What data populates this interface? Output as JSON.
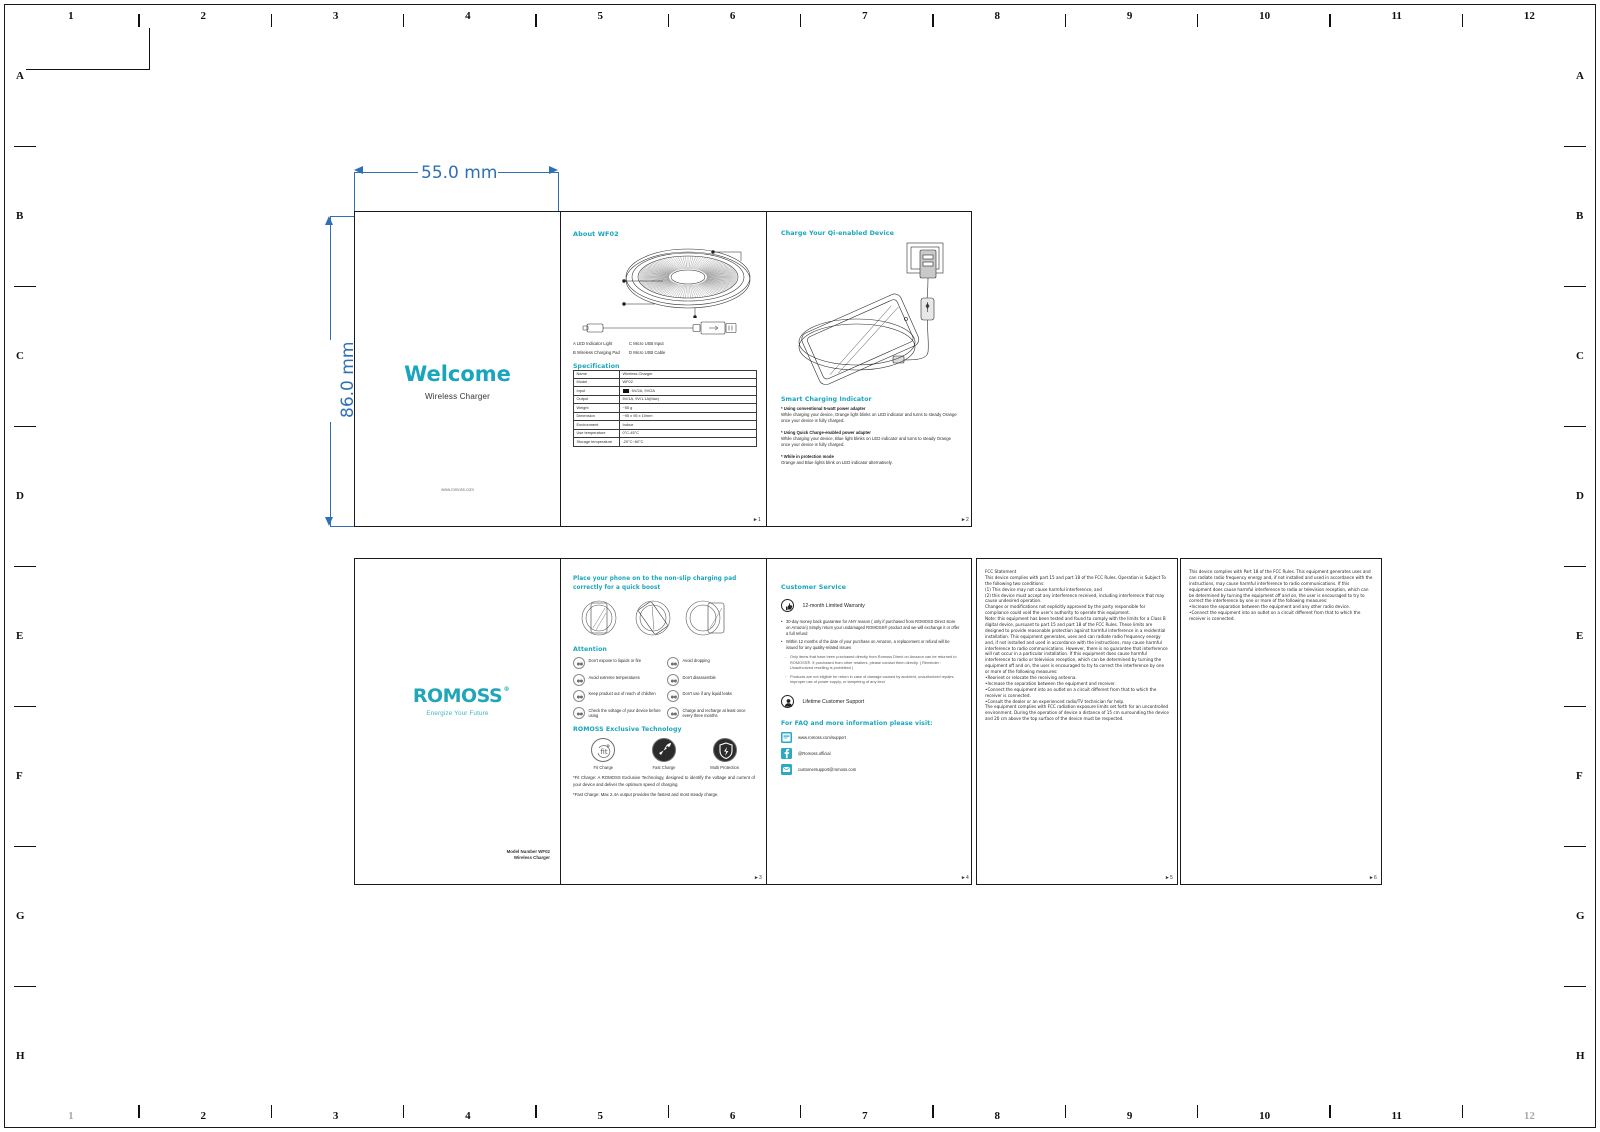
{
  "drawing": {
    "ruler_numbers_top": [
      "1",
      "2",
      "3",
      "4",
      "5",
      "6",
      "7",
      "8",
      "9",
      "10",
      "11",
      "12"
    ],
    "ruler_numbers_bottom": [
      "1",
      "2",
      "3",
      "4",
      "5",
      "6",
      "7",
      "8",
      "9",
      "10",
      "11",
      "12"
    ],
    "ruler_letters": [
      "A",
      "B",
      "C",
      "D",
      "E",
      "F",
      "G",
      "H"
    ],
    "dim_width": "55.0 mm",
    "dim_height": "86.0 mm"
  },
  "page1": {
    "title": "Welcome",
    "subtitle": "Wireless Charger",
    "url": "www.romoss.com",
    "page_mark": "►1"
  },
  "page2": {
    "about_heading": "About WF02",
    "legend": [
      "A  LED Indicator Light",
      "C  Micro USB Input",
      "B  Wireless Charging Pad",
      "D  Micro USB Cable"
    ],
    "spec_heading": "Specification",
    "spec_rows": [
      {
        "key": "Name",
        "value": "Wireless Charger"
      },
      {
        "key": "Model",
        "value": "WF02"
      },
      {
        "key": "Input",
        "value": ": 5V/2A, 9V/2A"
      },
      {
        "key": "Output",
        "value": "5V/1A, 9V/1.1A(Max)"
      },
      {
        "key": "Weight",
        "value": "~55 g"
      },
      {
        "key": "Dimension",
        "value": "~95 x 95 x 10mm"
      },
      {
        "key": "Environment",
        "value": "Indoor"
      },
      {
        "key": "Use temperature",
        "value": "0°C-45°C"
      },
      {
        "key": "Storage temperature",
        "value": "-20°C~60°C"
      }
    ]
  },
  "page3": {
    "heading": "Charge Your Qi-enabled Device",
    "indicator_heading": "Smart Charging Indicator",
    "blocks": [
      {
        "title": "* Using conventional 5-watt power adapter",
        "body": "While charging your device, Orange light blinks on LED indicator and turns to steady Orange once your device is fully charged."
      },
      {
        "title": "* Using Quick Charge-enabled power adapter",
        "body": "While charging your device, Blue light blinks on LED indicator and turns to steady Orange once your device is fully charged."
      },
      {
        "title": "* While in protection mode",
        "body": "Orange and Blue lights blink on LED indicator alternatively."
      }
    ],
    "page_mark": "►2"
  },
  "page4": {
    "logo": "ROMOSS",
    "logo_reg": "®",
    "tagline": "Energize Your Future",
    "footer_line1": "Model Number WF02",
    "footer_line2": "Wireless Charger"
  },
  "page5": {
    "heading": "Place your phone on to the non-slip charging pad correctly for a quick boost",
    "attention_heading": "Attention",
    "attention_items": [
      {
        "icon": "flame-drop-icon",
        "text": "Don't expose to liquids or fire"
      },
      {
        "icon": "drop-warning-icon",
        "text": "Avoid dropping"
      },
      {
        "icon": "thermometer-icon",
        "text": "Avoid extreme temperatures"
      },
      {
        "icon": "screwdriver-icon",
        "text": "Don't disassemble"
      },
      {
        "icon": "child-icon",
        "text": "Keep product out of reach of children"
      },
      {
        "icon": "liquid-leak-icon",
        "text": "Don't use if any liquid leaks"
      },
      {
        "icon": "voltage-icon",
        "text": "Check the voltage of your device before using"
      },
      {
        "icon": "recharge-icon",
        "text": "Charge and recharge at least once every three months"
      }
    ],
    "tech_heading": "ROMOSS Exclusive Technology",
    "tech_items": [
      {
        "icon": "fit-charge-icon",
        "label": "Fit Charge"
      },
      {
        "icon": "rocket-icon",
        "label": "Fast Charge"
      },
      {
        "icon": "shield-bolt-icon",
        "label": "Multi Protection"
      }
    ],
    "tech_note1": "*Fit Charge: A ROMOSS Exclusive Technology, designed to identify the voltage and current of your device and deliver the optimum speed of charging.",
    "tech_note2": "*Fast Charge: Max 2.4A output provides the fastest and most steady charge.",
    "page_mark": "►3"
  },
  "page6": {
    "heading": "Customer Service",
    "warranty_label": "12-month Limited Warranty",
    "bullets": [
      "30-day money back guarantee for ANY reason ( only if purchased from ROMOSS Direct store on Amazon) Simply return your undamaged ROMOSS® product and we will exchange it or offer a full refund",
      "Within 12 months of the date of your purchase on Amazon, a replacement or refund will be issued for any quality-related issues"
    ],
    "sub_bullets": [
      "Only items that have been purchased directly from Romoss Direct on Amazon can be returned to ROMOSS®. If purchased from other retailers, please contact them directly. ( Reminder : Unauthorized reselling is prohibited )",
      "Products are not eligible for return in case of damage caused by accident, unauthorized repairs, improper use of power supply, or tampering of any kind"
    ],
    "support_label": "Lifetime Customer Support",
    "faq_heading": "For FAQ and more information please visit:",
    "faq_items": [
      {
        "icon": "website-icon",
        "text": "www.romoss.com/support"
      },
      {
        "icon": "facebook-icon",
        "text": "@Romoss.official"
      },
      {
        "icon": "email-icon",
        "text": "customersupport@romoss.com"
      }
    ],
    "page_mark": "►4"
  },
  "page7": {
    "text": "FCC Statement\nThis device complies with part 15 and part 18 of the FCC Rules. Operation is Subject To the following two conditions:\n(1) This device may not cause harmful interference, and\n(2) this device must accept any interference received, including interference that may cause undesired operation.\nChanges or modifications not explicitly approved by the party responsible for compliance could void the user's authority to operate this equipment.\nNote: this equipment has been tested and found to comply with the limits for a Class B digital device, pursuant to part 15 and part 18 of the FCC Rules. These limits are designed to provide reasonable protection against harmful interference in a residential installation. This equipment generates, uses and can radiate radio frequency energy and, if not installed and used in accordance with the instructions, may cause harmful interference to radio communications. However, there is no guarantee that interference will not occur in a particular installation. If this equipment does cause harmful interference to radio or television reception, which can be determined by turning the equipment off and on, the user is encouraged to try to correct the interference by one or more of the following measures:\n•Reorient or relocate the receiving antenna.\n•Increase the separation between the equipment and receiver.\n•Connect the equipment into an outlet on a circuit different from that to which the receiver is connected.\n•Consult the dealer or an experienced radio/TV technician for help.\nThe equipment complies with FCC radiation exposure limits set forth for an uncontrolled environment. During the operation of device a distance of 15 cm surrounding the device and 20 cm above the top surface of the device must be respected.",
    "page_mark": "►5"
  },
  "page8": {
    "text": "This device complies with Part 18 of the FCC Rules. This equipment generates uses and can radiate radio frequency energy and, if not installed and used in accordance with the instructions, may cause harmful interference to radio communications. If this equipment does cause harmful interference to radio or television reception, which can be determined by turning the equipment off and on, the user is encouraged to try to correct the interference by one or more of the following measures:\n•Increase the separation between the equipment and any other radio device.\n•Connect the equipment into an outlet on a circuit different from that to which the receiver is connected.",
    "page_mark": "►6"
  },
  "colors": {
    "teal": "#18a5bd",
    "logo_teal": "#21a6b8",
    "dim_blue": "#2f6fb5",
    "ink": "#1b1b1b"
  }
}
